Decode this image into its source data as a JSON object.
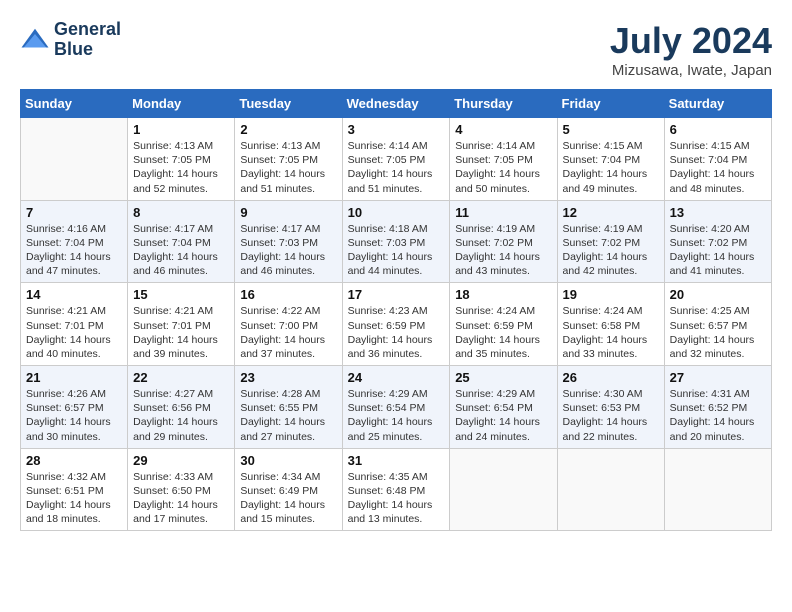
{
  "header": {
    "logo_line1": "General",
    "logo_line2": "Blue",
    "month": "July 2024",
    "location": "Mizusawa, Iwate, Japan"
  },
  "weekdays": [
    "Sunday",
    "Monday",
    "Tuesday",
    "Wednesday",
    "Thursday",
    "Friday",
    "Saturday"
  ],
  "weeks": [
    [
      {
        "day": "",
        "info": ""
      },
      {
        "day": "1",
        "info": "Sunrise: 4:13 AM\nSunset: 7:05 PM\nDaylight: 14 hours\nand 52 minutes."
      },
      {
        "day": "2",
        "info": "Sunrise: 4:13 AM\nSunset: 7:05 PM\nDaylight: 14 hours\nand 51 minutes."
      },
      {
        "day": "3",
        "info": "Sunrise: 4:14 AM\nSunset: 7:05 PM\nDaylight: 14 hours\nand 51 minutes."
      },
      {
        "day": "4",
        "info": "Sunrise: 4:14 AM\nSunset: 7:05 PM\nDaylight: 14 hours\nand 50 minutes."
      },
      {
        "day": "5",
        "info": "Sunrise: 4:15 AM\nSunset: 7:04 PM\nDaylight: 14 hours\nand 49 minutes."
      },
      {
        "day": "6",
        "info": "Sunrise: 4:15 AM\nSunset: 7:04 PM\nDaylight: 14 hours\nand 48 minutes."
      }
    ],
    [
      {
        "day": "7",
        "info": "Sunrise: 4:16 AM\nSunset: 7:04 PM\nDaylight: 14 hours\nand 47 minutes."
      },
      {
        "day": "8",
        "info": "Sunrise: 4:17 AM\nSunset: 7:04 PM\nDaylight: 14 hours\nand 46 minutes."
      },
      {
        "day": "9",
        "info": "Sunrise: 4:17 AM\nSunset: 7:03 PM\nDaylight: 14 hours\nand 46 minutes."
      },
      {
        "day": "10",
        "info": "Sunrise: 4:18 AM\nSunset: 7:03 PM\nDaylight: 14 hours\nand 44 minutes."
      },
      {
        "day": "11",
        "info": "Sunrise: 4:19 AM\nSunset: 7:02 PM\nDaylight: 14 hours\nand 43 minutes."
      },
      {
        "day": "12",
        "info": "Sunrise: 4:19 AM\nSunset: 7:02 PM\nDaylight: 14 hours\nand 42 minutes."
      },
      {
        "day": "13",
        "info": "Sunrise: 4:20 AM\nSunset: 7:02 PM\nDaylight: 14 hours\nand 41 minutes."
      }
    ],
    [
      {
        "day": "14",
        "info": "Sunrise: 4:21 AM\nSunset: 7:01 PM\nDaylight: 14 hours\nand 40 minutes."
      },
      {
        "day": "15",
        "info": "Sunrise: 4:21 AM\nSunset: 7:01 PM\nDaylight: 14 hours\nand 39 minutes."
      },
      {
        "day": "16",
        "info": "Sunrise: 4:22 AM\nSunset: 7:00 PM\nDaylight: 14 hours\nand 37 minutes."
      },
      {
        "day": "17",
        "info": "Sunrise: 4:23 AM\nSunset: 6:59 PM\nDaylight: 14 hours\nand 36 minutes."
      },
      {
        "day": "18",
        "info": "Sunrise: 4:24 AM\nSunset: 6:59 PM\nDaylight: 14 hours\nand 35 minutes."
      },
      {
        "day": "19",
        "info": "Sunrise: 4:24 AM\nSunset: 6:58 PM\nDaylight: 14 hours\nand 33 minutes."
      },
      {
        "day": "20",
        "info": "Sunrise: 4:25 AM\nSunset: 6:57 PM\nDaylight: 14 hours\nand 32 minutes."
      }
    ],
    [
      {
        "day": "21",
        "info": "Sunrise: 4:26 AM\nSunset: 6:57 PM\nDaylight: 14 hours\nand 30 minutes."
      },
      {
        "day": "22",
        "info": "Sunrise: 4:27 AM\nSunset: 6:56 PM\nDaylight: 14 hours\nand 29 minutes."
      },
      {
        "day": "23",
        "info": "Sunrise: 4:28 AM\nSunset: 6:55 PM\nDaylight: 14 hours\nand 27 minutes."
      },
      {
        "day": "24",
        "info": "Sunrise: 4:29 AM\nSunset: 6:54 PM\nDaylight: 14 hours\nand 25 minutes."
      },
      {
        "day": "25",
        "info": "Sunrise: 4:29 AM\nSunset: 6:54 PM\nDaylight: 14 hours\nand 24 minutes."
      },
      {
        "day": "26",
        "info": "Sunrise: 4:30 AM\nSunset: 6:53 PM\nDaylight: 14 hours\nand 22 minutes."
      },
      {
        "day": "27",
        "info": "Sunrise: 4:31 AM\nSunset: 6:52 PM\nDaylight: 14 hours\nand 20 minutes."
      }
    ],
    [
      {
        "day": "28",
        "info": "Sunrise: 4:32 AM\nSunset: 6:51 PM\nDaylight: 14 hours\nand 18 minutes."
      },
      {
        "day": "29",
        "info": "Sunrise: 4:33 AM\nSunset: 6:50 PM\nDaylight: 14 hours\nand 17 minutes."
      },
      {
        "day": "30",
        "info": "Sunrise: 4:34 AM\nSunset: 6:49 PM\nDaylight: 14 hours\nand 15 minutes."
      },
      {
        "day": "31",
        "info": "Sunrise: 4:35 AM\nSunset: 6:48 PM\nDaylight: 14 hours\nand 13 minutes."
      },
      {
        "day": "",
        "info": ""
      },
      {
        "day": "",
        "info": ""
      },
      {
        "day": "",
        "info": ""
      }
    ]
  ]
}
